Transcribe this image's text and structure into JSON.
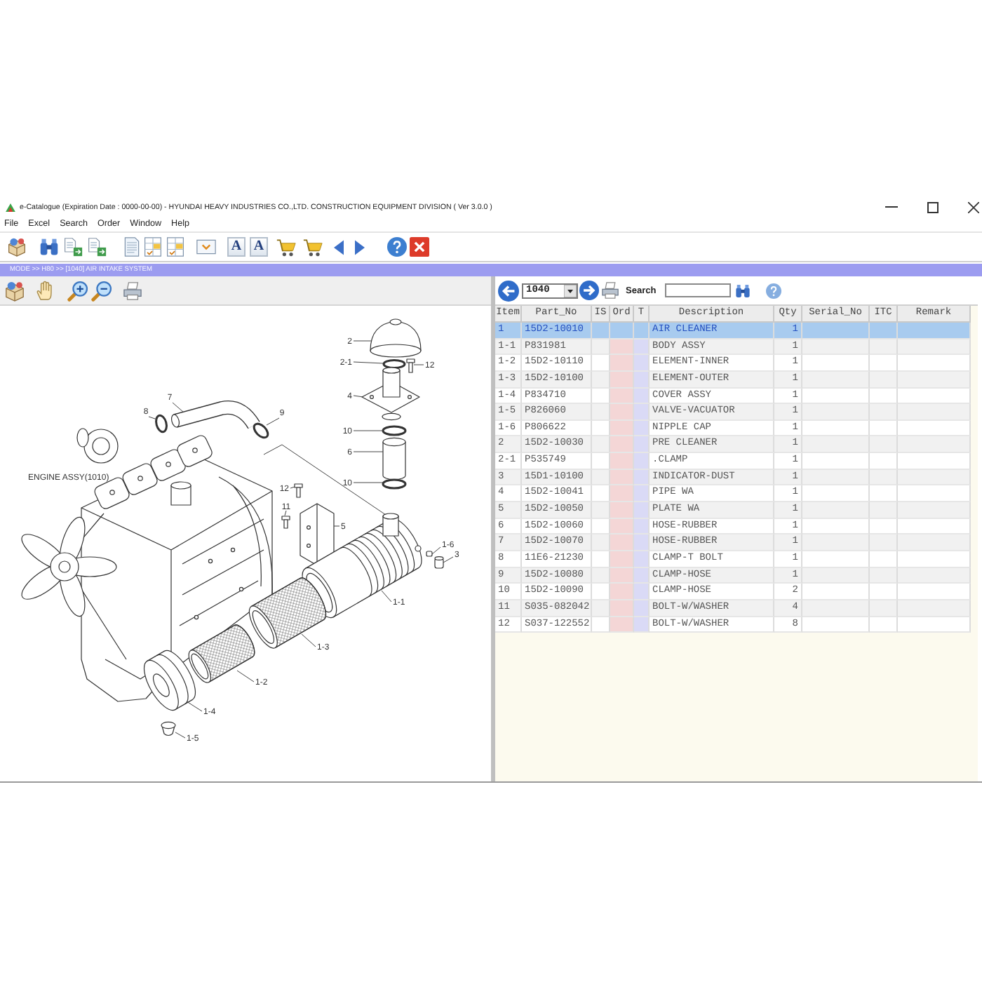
{
  "window": {
    "title": "e-Catalogue (Expiration Date : 0000-00-00) - HYUNDAI HEAVY INDUSTRIES CO.,LTD. CONSTRUCTION EQUIPMENT DIVISION ( Ver 3.0.0 )"
  },
  "menu": [
    "File",
    "Excel",
    "Search",
    "Order",
    "Window",
    "Help"
  ],
  "toolbar": {
    "font_buttons": [
      "A",
      "A"
    ]
  },
  "breadcrumb": "MODE >> H80 >> [1040] AIR INTAKE SYSTEM",
  "diagram": {
    "engine_label": "ENGINE ASSY(1010)",
    "callouts": [
      "2",
      "2-1",
      "12",
      "4",
      "7",
      "8",
      "9",
      "10",
      "6",
      "10",
      "12",
      "11",
      "5",
      "1-6",
      "3",
      "1-1",
      "1-3",
      "1-2",
      "1-4",
      "1-5"
    ]
  },
  "parts_panel": {
    "group": "1040",
    "search": {
      "label": "Search"
    },
    "table": {
      "columns": [
        "Item",
        "Part_No",
        "IS",
        "Ord",
        "T",
        "Description",
        "Qty",
        "Serial_No",
        "ITC",
        "Remark"
      ],
      "rows": [
        {
          "item": "1",
          "part_no": "15D2-10010",
          "description": "AIR CLEANER",
          "qty": "1",
          "selected": true
        },
        {
          "item": "1-1",
          "part_no": "P831981",
          "description": "BODY ASSY",
          "qty": "1",
          "selected": false
        },
        {
          "item": "1-2",
          "part_no": "15D2-10110",
          "description": "ELEMENT-INNER",
          "qty": "1",
          "selected": false
        },
        {
          "item": "1-3",
          "part_no": "15D2-10100",
          "description": "ELEMENT-OUTER",
          "qty": "1",
          "selected": false
        },
        {
          "item": "1-4",
          "part_no": "P834710",
          "description": "COVER ASSY",
          "qty": "1",
          "selected": false
        },
        {
          "item": "1-5",
          "part_no": "P826060",
          "description": "VALVE-VACUATOR",
          "qty": "1",
          "selected": false
        },
        {
          "item": "1-6",
          "part_no": "P806622",
          "description": "NIPPLE CAP",
          "qty": "1",
          "selected": false
        },
        {
          "item": "2",
          "part_no": "15D2-10030",
          "description": "PRE CLEANER",
          "qty": "1",
          "selected": false
        },
        {
          "item": "2-1",
          "part_no": "P535749",
          "description": ".CLAMP",
          "qty": "1",
          "selected": false
        },
        {
          "item": "3",
          "part_no": "15D1-10100",
          "description": "INDICATOR-DUST",
          "qty": "1",
          "selected": false
        },
        {
          "item": "4",
          "part_no": "15D2-10041",
          "description": "PIPE WA",
          "qty": "1",
          "selected": false
        },
        {
          "item": "5",
          "part_no": "15D2-10050",
          "description": "PLATE WA",
          "qty": "1",
          "selected": false
        },
        {
          "item": "6",
          "part_no": "15D2-10060",
          "description": "HOSE-RUBBER",
          "qty": "1",
          "selected": false
        },
        {
          "item": "7",
          "part_no": "15D2-10070",
          "description": "HOSE-RUBBER",
          "qty": "1",
          "selected": false
        },
        {
          "item": "8",
          "part_no": "11E6-21230",
          "description": "CLAMP-T BOLT",
          "qty": "1",
          "selected": false
        },
        {
          "item": "9",
          "part_no": "15D2-10080",
          "description": "CLAMP-HOSE",
          "qty": "1",
          "selected": false
        },
        {
          "item": "10",
          "part_no": "15D2-10090",
          "description": "CLAMP-HOSE",
          "qty": "2",
          "selected": false
        },
        {
          "item": "11",
          "part_no": "S035-082042",
          "description": "BOLT-W/WASHER",
          "qty": "4",
          "selected": false
        },
        {
          "item": "12",
          "part_no": "S037-122552",
          "description": "BOLT-W/WASHER",
          "qty": "8",
          "selected": false
        }
      ]
    }
  }
}
